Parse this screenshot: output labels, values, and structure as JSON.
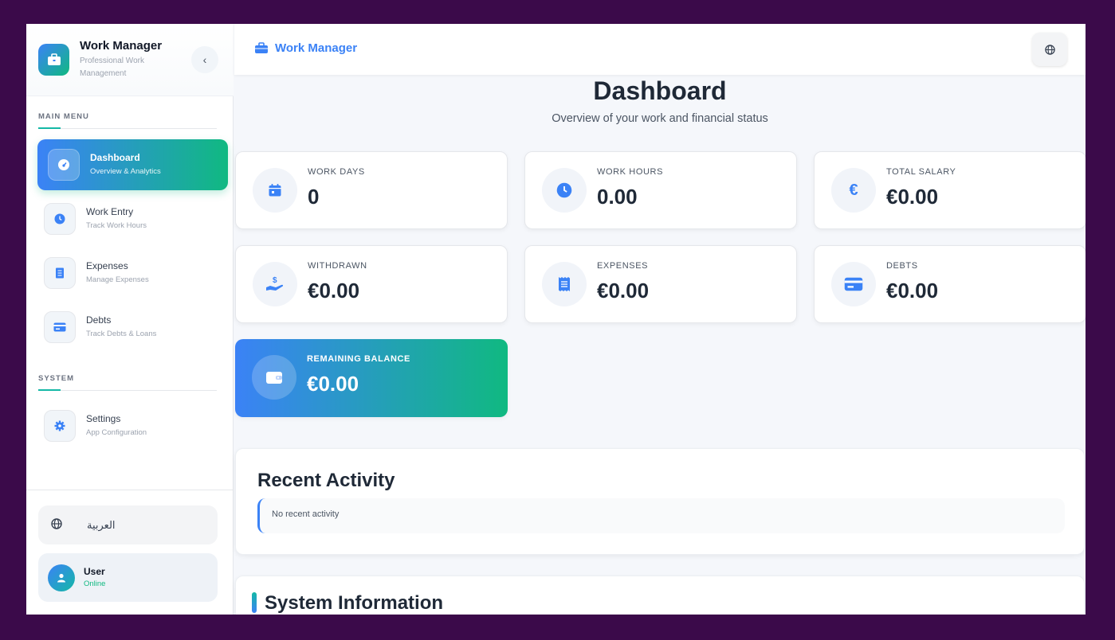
{
  "app": {
    "name": "Work Manager",
    "tagline": "Professional Work Management"
  },
  "sidebar": {
    "collapse_icon": "chevron-left-icon",
    "sections": {
      "main_menu": "MAIN MENU",
      "system": "SYSTEM"
    },
    "items": [
      {
        "title": "Dashboard",
        "subtitle": "Overview & Analytics",
        "icon": "gauge-icon",
        "active": true
      },
      {
        "title": "Work Entry",
        "subtitle": "Track Work Hours",
        "icon": "clock-icon",
        "active": false
      },
      {
        "title": "Expenses",
        "subtitle": "Manage Expenses",
        "icon": "receipt-icon",
        "active": false
      },
      {
        "title": "Debts",
        "subtitle": "Track Debts & Loans",
        "icon": "credit-card-icon",
        "active": false
      },
      {
        "title": "Settings",
        "subtitle": "App Configuration",
        "icon": "gear-icon",
        "active": false
      }
    ],
    "language_button": "العربية",
    "user": {
      "name": "User",
      "status": "Online"
    }
  },
  "header": {
    "title": "Work Manager",
    "language_icon": "globe-icon"
  },
  "main": {
    "title": "Dashboard",
    "subtitle": "Overview of your work and financial status",
    "stats": [
      {
        "label": "WORK DAYS",
        "value": "0",
        "icon": "calendar-icon"
      },
      {
        "label": "WORK HOURS",
        "value": "0.00",
        "icon": "clock-icon"
      },
      {
        "label": "TOTAL SALARY",
        "value": "€0.00",
        "icon": "euro-icon"
      },
      {
        "label": "WITHDRAWN",
        "value": "€0.00",
        "icon": "hand-dollar-icon"
      },
      {
        "label": "EXPENSES",
        "value": "€0.00",
        "icon": "receipt-icon"
      },
      {
        "label": "DEBTS",
        "value": "€0.00",
        "icon": "credit-card-icon"
      },
      {
        "label": "REMAINING BALANCE",
        "value": "€0.00",
        "icon": "wallet-icon"
      }
    ],
    "recent_activity": {
      "title": "Recent Activity",
      "empty_text": "No recent activity"
    },
    "system_info": {
      "title": "System Information"
    }
  },
  "colors": {
    "primary": "#3b82f6",
    "accent": "#10b981",
    "frame": "#3b0a4a"
  }
}
